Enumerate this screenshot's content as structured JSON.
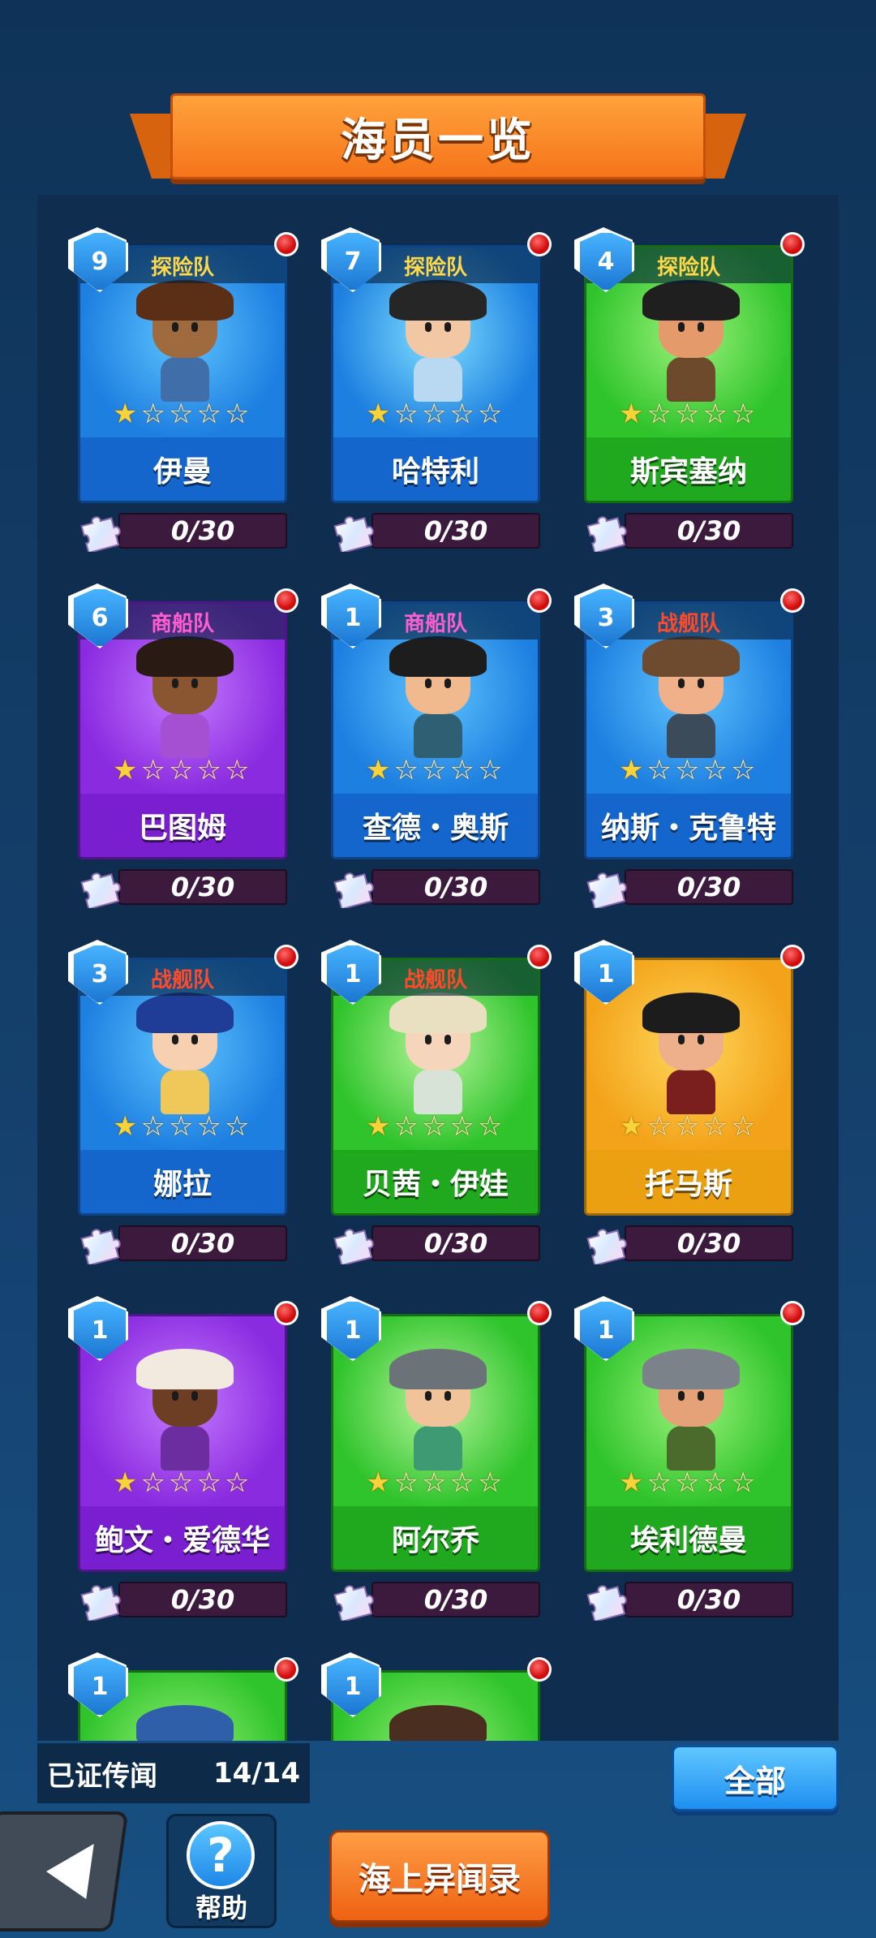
{
  "title": "海员一览",
  "cards": [
    {
      "level": "9",
      "team": "探险队",
      "team_color": "#ffd84a",
      "name": "伊曼",
      "progress": "0/30",
      "stars": 1,
      "bg": "#1d7fe0",
      "bg_light": "#5fc4ff",
      "bar": "#1566cc",
      "skin": "#a06a3f",
      "hat": "#5a2f16",
      "body": "#3f6ea8"
    },
    {
      "level": "7",
      "team": "探险队",
      "team_color": "#ffd84a",
      "name": "哈特利",
      "progress": "0/30",
      "stars": 1,
      "bg": "#1d7fe0",
      "bg_light": "#7fe0ff",
      "bar": "#1566cc",
      "skin": "#f2c7a3",
      "hat": "#262626",
      "body": "#b9d8f2"
    },
    {
      "level": "4",
      "team": "探险队",
      "team_color": "#ffd84a",
      "name": "斯宾塞纳",
      "progress": "0/30",
      "stars": 1,
      "bg": "#2fc42c",
      "bg_light": "#9cf27a",
      "bar": "#20a81f",
      "skin": "#e59a6c",
      "hat": "#1f1f1f",
      "body": "#6c4a2b"
    },
    {
      "level": "6",
      "team": "商船队",
      "team_color": "#ff5ecf",
      "name": "巴图姆",
      "progress": "0/30",
      "stars": 1,
      "bg": "#8a2be0",
      "bg_light": "#c47bff",
      "bar": "#7a1fd0",
      "skin": "#8a5632",
      "hat": "#2a1a14",
      "body": "#a54fd2"
    },
    {
      "level": "1",
      "team": "商船队",
      "team_color": "#ff5ecf",
      "name": "查德・奥斯",
      "progress": "0/30",
      "stars": 1,
      "bg": "#1d7fe0",
      "bg_light": "#5fc4ff",
      "bar": "#1566cc",
      "skin": "#f0b98e",
      "hat": "#1d1d1d",
      "body": "#2f5f73"
    },
    {
      "level": "3",
      "team": "战舰队",
      "team_color": "#ff4a2a",
      "name": "纳斯・克鲁特",
      "progress": "0/30",
      "stars": 1,
      "bg": "#1d7fe0",
      "bg_light": "#5fc4ff",
      "bar": "#1566cc",
      "skin": "#f0b08a",
      "hat": "#6e4a2e",
      "body": "#3b4b5a"
    },
    {
      "level": "3",
      "team": "战舰队",
      "team_color": "#ff4a2a",
      "name": "娜拉",
      "progress": "0/30",
      "stars": 1,
      "bg": "#1d7fe0",
      "bg_light": "#5fc4ff",
      "bar": "#1566cc",
      "skin": "#f6d0b0",
      "hat": "#1f3d96",
      "body": "#f0c85a"
    },
    {
      "level": "1",
      "team": "战舰队",
      "team_color": "#ff4a2a",
      "name": "贝茜・伊娃",
      "progress": "0/30",
      "stars": 1,
      "bg": "#2fc42c",
      "bg_light": "#b6f59a",
      "bar": "#20a81f",
      "skin": "#f6d5bd",
      "hat": "#e9e0c2",
      "body": "#d7e3d7"
    },
    {
      "level": "1",
      "team": "",
      "team_color": "#ffffff",
      "name": "托马斯",
      "progress": "0/30",
      "stars": 1,
      "bg": "#f3a31a",
      "bg_light": "#ffd75a",
      "bar": "#eaa011",
      "skin": "#eeb08a",
      "hat": "#1c1c1c",
      "body": "#7a1e1e"
    },
    {
      "level": "1",
      "team": "",
      "team_color": "#ffffff",
      "name": "鲍文・爱德华",
      "progress": "0/30",
      "stars": 1,
      "bg": "#8a2be0",
      "bg_light": "#c47bff",
      "bar": "#7a1fd0",
      "skin": "#6e3e24",
      "hat": "#f3eadf",
      "body": "#6b2da0"
    },
    {
      "level": "1",
      "team": "",
      "team_color": "#ffffff",
      "name": "阿尔乔",
      "progress": "0/30",
      "stars": 1,
      "bg": "#2fc42c",
      "bg_light": "#b6f59a",
      "bar": "#20a81f",
      "skin": "#f0c39a",
      "hat": "#6b7278",
      "body": "#3d9a72"
    },
    {
      "level": "1",
      "team": "",
      "team_color": "#ffffff",
      "name": "埃利德曼",
      "progress": "0/30",
      "stars": 1,
      "bg": "#2fc42c",
      "bg_light": "#9cf27a",
      "bar": "#20a81f",
      "skin": "#e5a178",
      "hat": "#7b828a",
      "body": "#4a6b2b"
    },
    {
      "level": "1",
      "team": "",
      "team_color": "#ffffff",
      "name": "",
      "progress": "",
      "stars": 0,
      "bg": "#2fc42c",
      "bg_light": "#9cf27a",
      "bar": "#20a81f",
      "skin": "#f0b08a",
      "hat": "#2f5fa8",
      "body": "#3a3a3a"
    },
    {
      "level": "1",
      "team": "",
      "team_color": "#ffffff",
      "name": "",
      "progress": "",
      "stars": 0,
      "bg": "#2fc42c",
      "bg_light": "#9cf27a",
      "bar": "#20a81f",
      "skin": "#f0b08a",
      "hat": "#4a2e1f",
      "body": "#3a3a3a"
    }
  ],
  "footer": {
    "legend_label": "已证传闻",
    "legend_count": "14/14",
    "all_button": "全部",
    "help_label": "帮助",
    "help_icon": "?",
    "log_button": "海上异闻录"
  }
}
